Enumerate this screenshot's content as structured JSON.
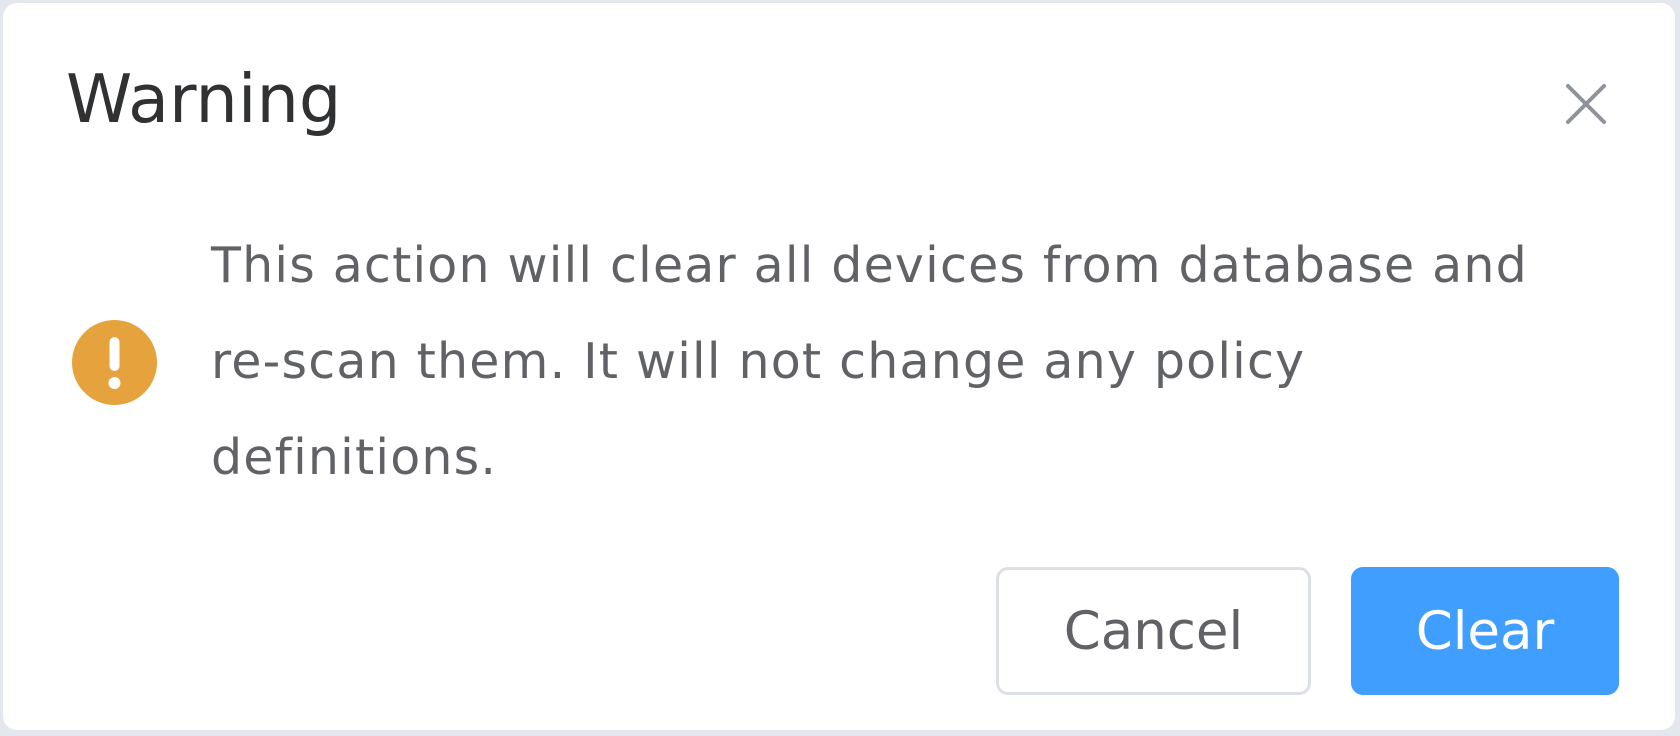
{
  "dialog": {
    "title": "Warning",
    "message": "This action will clear all devices from database and re-scan them. It will not change any policy definitions.",
    "cancel_label": "Cancel",
    "confirm_label": "Clear",
    "icons": {
      "close": "close-icon",
      "warning": "warning-icon"
    },
    "colors": {
      "warning": "#e6a23c",
      "primary": "#409eff",
      "title": "#303133",
      "text": "#606266",
      "border": "#dcdfe6"
    }
  }
}
